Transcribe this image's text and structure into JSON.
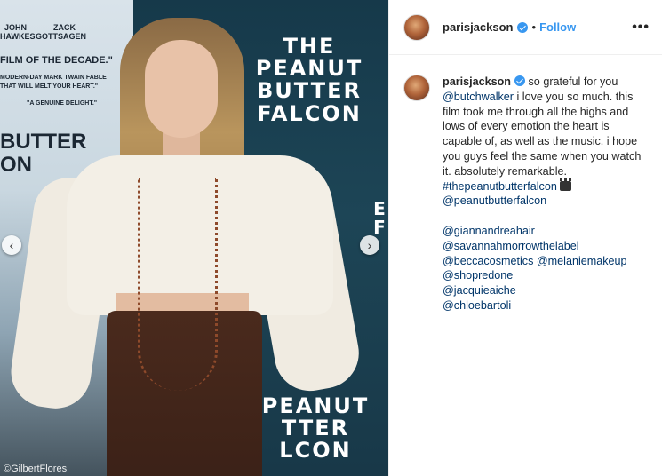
{
  "photo": {
    "poster_left_lines": [
      "JOHN",
      "HAWKES",
      "ZACK",
      "GOTTSAGEN",
      "FILM OF THE DECADE.\"",
      "MODERN-DAY MARK TWAIN FABLE",
      "THAT WILL MELT YOUR HEART.\"",
      "\"A GENUINE DELIGHT.\"",
      "BUTTER",
      "ON"
    ],
    "poster_title_top": "THE\nPEANUT\nBUTTER\nFALCON",
    "poster_title_bottom": "PEANUT\nTTER\nLCON",
    "poster_right_edge": "E\nF",
    "credit": "©GilbertFlores",
    "prev_icon": "chevron-left-icon",
    "next_icon": "chevron-right-icon"
  },
  "header": {
    "username": "parisjackson",
    "separator": "•",
    "follow_label": "Follow",
    "more_label": "•••"
  },
  "caption": {
    "username": "parisjackson",
    "text_start": " so grateful for you ",
    "mention_butch": "@butchwalker",
    "text_mid": " i love you so much. this film took me through all the highs and lows of every emotion the heart is capable of, as well as the music. i hope you guys feel the same when you watch it. absolutely remarkable. ",
    "hashtag": "#thepeanutbutterfalcon",
    "mention_film": "@peanutbutterfalcon",
    "mentions": [
      "@giannandreahair",
      "@savannahmorrowthelabel",
      "@beccacosmetics @melaniemakeup",
      "@shopredone",
      "@jacquieaiche",
      "@chloebartoli"
    ]
  },
  "colors": {
    "link": "#003569",
    "follow": "#3897f0",
    "verified": "#3897f0"
  }
}
